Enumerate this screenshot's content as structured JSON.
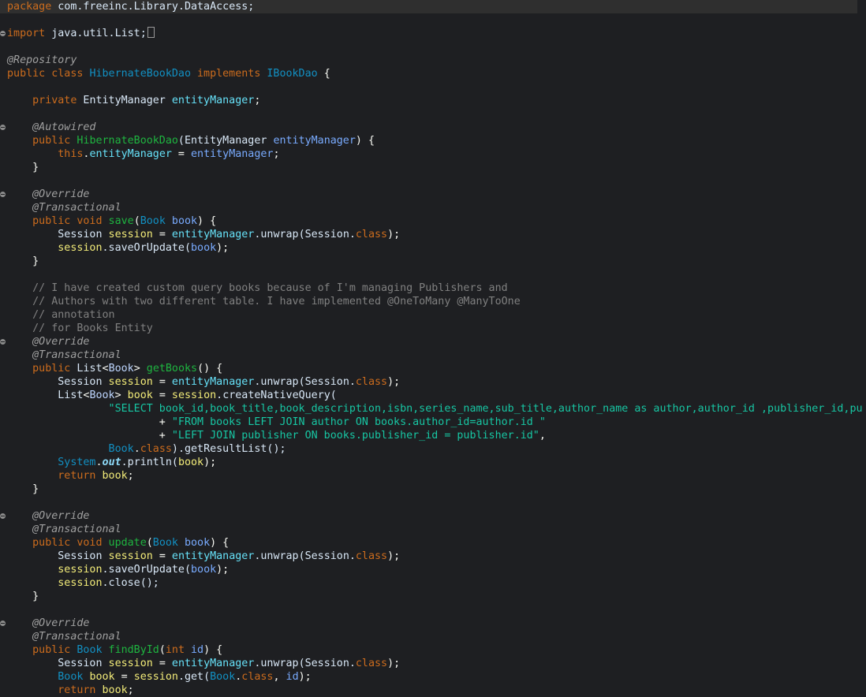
{
  "editor": {
    "language": "java",
    "current_line": 0,
    "lines": [
      {
        "fold": false,
        "folded_box": false,
        "tokens": [
          {
            "t": "package",
            "c": "#cc6c1d"
          },
          {
            "t": " com.freeinc.Library.DataAccess;",
            "c": "#d9e8f7"
          }
        ]
      },
      {
        "fold": false,
        "folded_box": false,
        "tokens": []
      },
      {
        "fold": true,
        "folded_box": true,
        "tokens": [
          {
            "t": "import",
            "c": "#cc6c1d"
          },
          {
            "t": " java.util.List;",
            "c": "#d9e8f7"
          }
        ]
      },
      {
        "fold": false,
        "folded_box": false,
        "tokens": []
      },
      {
        "fold": false,
        "folded_box": false,
        "tokens": [
          {
            "t": "@Repository",
            "c": "#a0a0a0",
            "i": true
          }
        ]
      },
      {
        "fold": false,
        "folded_box": false,
        "tokens": [
          {
            "t": "public class ",
            "c": "#cc6c1d"
          },
          {
            "t": "HibernateBookDao",
            "c": "#1290c3"
          },
          {
            "t": " implements ",
            "c": "#cc6c1d"
          },
          {
            "t": "IBookDao",
            "c": "#1290c3"
          },
          {
            "t": " {",
            "c": "#f9faf4"
          }
        ]
      },
      {
        "fold": false,
        "folded_box": false,
        "tokens": []
      },
      {
        "fold": false,
        "folded_box": false,
        "tokens": [
          {
            "t": "    private ",
            "c": "#cc6c1d"
          },
          {
            "t": "EntityManager",
            "c": "#d9e8f7"
          },
          {
            "t": " entityManager",
            "c": "#66e1f8"
          },
          {
            "t": ";",
            "c": "#f9faf4"
          }
        ]
      },
      {
        "fold": false,
        "folded_box": false,
        "tokens": []
      },
      {
        "fold": true,
        "folded_box": false,
        "tokens": [
          {
            "t": "    @Autowired",
            "c": "#a0a0a0",
            "i": true
          }
        ]
      },
      {
        "fold": false,
        "folded_box": false,
        "tokens": [
          {
            "t": "    public ",
            "c": "#cc6c1d"
          },
          {
            "t": "HibernateBookDao",
            "c": "#1eb540"
          },
          {
            "t": "(EntityManager ",
            "c": "#d9e8f7"
          },
          {
            "t": "entityManager",
            "c": "#79abff"
          },
          {
            "t": ") {",
            "c": "#f9faf4"
          }
        ]
      },
      {
        "fold": false,
        "folded_box": false,
        "tokens": [
          {
            "t": "        this",
            "c": "#cc6c1d"
          },
          {
            "t": ".",
            "c": "#f9faf4"
          },
          {
            "t": "entityManager",
            "c": "#66e1f8"
          },
          {
            "t": " = ",
            "c": "#f9faf4"
          },
          {
            "t": "entityManager",
            "c": "#79abff"
          },
          {
            "t": ";",
            "c": "#f9faf4"
          }
        ]
      },
      {
        "fold": false,
        "folded_box": false,
        "tokens": [
          {
            "t": "    }",
            "c": "#f9faf4"
          }
        ]
      },
      {
        "fold": false,
        "folded_box": false,
        "tokens": []
      },
      {
        "fold": true,
        "folded_box": false,
        "tokens": [
          {
            "t": "    @Override",
            "c": "#a0a0a0",
            "i": true
          }
        ]
      },
      {
        "fold": false,
        "folded_box": false,
        "tokens": [
          {
            "t": "    @Transactional",
            "c": "#a0a0a0",
            "i": true
          }
        ]
      },
      {
        "fold": false,
        "folded_box": false,
        "tokens": [
          {
            "t": "    public void ",
            "c": "#cc6c1d"
          },
          {
            "t": "save",
            "c": "#1eb540"
          },
          {
            "t": "(",
            "c": "#f9faf4"
          },
          {
            "t": "Book",
            "c": "#1290c3"
          },
          {
            "t": " book",
            "c": "#79abff"
          },
          {
            "t": ") {",
            "c": "#f9faf4"
          }
        ]
      },
      {
        "fold": false,
        "folded_box": false,
        "tokens": [
          {
            "t": "        Session ",
            "c": "#d9e8f7"
          },
          {
            "t": "session",
            "c": "#f3ec79"
          },
          {
            "t": " = ",
            "c": "#f9faf4"
          },
          {
            "t": "entityManager",
            "c": "#66e1f8"
          },
          {
            "t": ".unwrap(Session.",
            "c": "#d9e8f7"
          },
          {
            "t": "class",
            "c": "#cc6c1d"
          },
          {
            "t": ");",
            "c": "#f9faf4"
          }
        ]
      },
      {
        "fold": false,
        "folded_box": false,
        "tokens": [
          {
            "t": "        session",
            "c": "#f3ec79"
          },
          {
            "t": ".saveOrUpdate(",
            "c": "#d9e8f7"
          },
          {
            "t": "book",
            "c": "#79abff"
          },
          {
            "t": ");",
            "c": "#f9faf4"
          }
        ]
      },
      {
        "fold": false,
        "folded_box": false,
        "tokens": [
          {
            "t": "    }",
            "c": "#f9faf4"
          }
        ]
      },
      {
        "fold": false,
        "folded_box": false,
        "tokens": []
      },
      {
        "fold": false,
        "folded_box": false,
        "tokens": [
          {
            "t": "    // I have created custom query books because of I'm managing Publishers and",
            "c": "#808080"
          }
        ]
      },
      {
        "fold": false,
        "folded_box": false,
        "tokens": [
          {
            "t": "    // Authors with two different table. I have implemented @OneToMany @ManyToOne",
            "c": "#808080"
          }
        ]
      },
      {
        "fold": false,
        "folded_box": false,
        "tokens": [
          {
            "t": "    // annotation",
            "c": "#808080"
          }
        ]
      },
      {
        "fold": false,
        "folded_box": false,
        "tokens": [
          {
            "t": "    // for Books Entity",
            "c": "#808080"
          }
        ]
      },
      {
        "fold": true,
        "folded_box": false,
        "tokens": [
          {
            "t": "    @Override",
            "c": "#a0a0a0",
            "i": true
          }
        ]
      },
      {
        "fold": false,
        "folded_box": false,
        "tokens": [
          {
            "t": "    @Transactional",
            "c": "#a0a0a0",
            "i": true
          }
        ]
      },
      {
        "fold": false,
        "folded_box": false,
        "tokens": [
          {
            "t": "    public ",
            "c": "#cc6c1d"
          },
          {
            "t": "List",
            "c": "#d9e8f7"
          },
          {
            "t": "<",
            "c": "#f9faf4"
          },
          {
            "t": "Book",
            "c": "#bed6ff"
          },
          {
            "t": "> ",
            "c": "#f9faf4"
          },
          {
            "t": "getBooks",
            "c": "#1eb540"
          },
          {
            "t": "() {",
            "c": "#f9faf4"
          }
        ]
      },
      {
        "fold": false,
        "folded_box": false,
        "tokens": [
          {
            "t": "        Session ",
            "c": "#d9e8f7"
          },
          {
            "t": "session",
            "c": "#f3ec79"
          },
          {
            "t": " = ",
            "c": "#f9faf4"
          },
          {
            "t": "entityManager",
            "c": "#66e1f8"
          },
          {
            "t": ".unwrap(Session.",
            "c": "#d9e8f7"
          },
          {
            "t": "class",
            "c": "#cc6c1d"
          },
          {
            "t": ");",
            "c": "#f9faf4"
          }
        ]
      },
      {
        "fold": false,
        "folded_box": false,
        "tokens": [
          {
            "t": "        List",
            "c": "#d9e8f7"
          },
          {
            "t": "<",
            "c": "#f9faf4"
          },
          {
            "t": "Book",
            "c": "#bed6ff"
          },
          {
            "t": "> ",
            "c": "#f9faf4"
          },
          {
            "t": "book",
            "c": "#f3ec79"
          },
          {
            "t": " = ",
            "c": "#f9faf4"
          },
          {
            "t": "session",
            "c": "#f3ec79"
          },
          {
            "t": ".createNativeQuery(",
            "c": "#d9e8f7"
          }
        ]
      },
      {
        "fold": false,
        "folded_box": false,
        "tokens": [
          {
            "t": "                \"SELECT book_id,book_title,book_description,isbn,series_name,sub_title,author_name as author,author_id ,publisher_id,pu",
            "c": "#17c6a3"
          }
        ]
      },
      {
        "fold": false,
        "folded_box": false,
        "tokens": [
          {
            "t": "                        + ",
            "c": "#f9faf4"
          },
          {
            "t": "\"FROM books LEFT JOIN author ON books.author_id=author.id \"",
            "c": "#17c6a3"
          }
        ]
      },
      {
        "fold": false,
        "folded_box": false,
        "tokens": [
          {
            "t": "                        + ",
            "c": "#f9faf4"
          },
          {
            "t": "\"LEFT JOIN publisher ON books.publisher_id = publisher.id\"",
            "c": "#17c6a3"
          },
          {
            "t": ",",
            "c": "#f9faf4"
          }
        ]
      },
      {
        "fold": false,
        "folded_box": false,
        "tokens": [
          {
            "t": "                Book",
            "c": "#1290c3"
          },
          {
            "t": ".",
            "c": "#f9faf4"
          },
          {
            "t": "class",
            "c": "#cc6c1d"
          },
          {
            "t": ").getResultList();",
            "c": "#d9e8f7"
          }
        ]
      },
      {
        "fold": false,
        "folded_box": false,
        "tokens": [
          {
            "t": "        System",
            "c": "#1290c3"
          },
          {
            "t": ".",
            "c": "#f9faf4"
          },
          {
            "t": "out",
            "c": "#8dd9f8",
            "i": true,
            "b": true
          },
          {
            "t": ".println(",
            "c": "#d9e8f7"
          },
          {
            "t": "book",
            "c": "#f3ec79"
          },
          {
            "t": ");",
            "c": "#f9faf4"
          }
        ]
      },
      {
        "fold": false,
        "folded_box": false,
        "tokens": [
          {
            "t": "        return ",
            "c": "#cc6c1d"
          },
          {
            "t": "book",
            "c": "#f3ec79"
          },
          {
            "t": ";",
            "c": "#f9faf4"
          }
        ]
      },
      {
        "fold": false,
        "folded_box": false,
        "tokens": [
          {
            "t": "    }",
            "c": "#f9faf4"
          }
        ]
      },
      {
        "fold": false,
        "folded_box": false,
        "tokens": []
      },
      {
        "fold": true,
        "folded_box": false,
        "tokens": [
          {
            "t": "    @Override",
            "c": "#a0a0a0",
            "i": true
          }
        ]
      },
      {
        "fold": false,
        "folded_box": false,
        "tokens": [
          {
            "t": "    @Transactional",
            "c": "#a0a0a0",
            "i": true
          }
        ]
      },
      {
        "fold": false,
        "folded_box": false,
        "tokens": [
          {
            "t": "    public void ",
            "c": "#cc6c1d"
          },
          {
            "t": "update",
            "c": "#1eb540"
          },
          {
            "t": "(",
            "c": "#f9faf4"
          },
          {
            "t": "Book",
            "c": "#1290c3"
          },
          {
            "t": " book",
            "c": "#79abff"
          },
          {
            "t": ") {",
            "c": "#f9faf4"
          }
        ]
      },
      {
        "fold": false,
        "folded_box": false,
        "tokens": [
          {
            "t": "        Session ",
            "c": "#d9e8f7"
          },
          {
            "t": "session",
            "c": "#f3ec79"
          },
          {
            "t": " = ",
            "c": "#f9faf4"
          },
          {
            "t": "entityManager",
            "c": "#66e1f8"
          },
          {
            "t": ".unwrap(Session.",
            "c": "#d9e8f7"
          },
          {
            "t": "class",
            "c": "#cc6c1d"
          },
          {
            "t": ");",
            "c": "#f9faf4"
          }
        ]
      },
      {
        "fold": false,
        "folded_box": false,
        "tokens": [
          {
            "t": "        session",
            "c": "#f3ec79"
          },
          {
            "t": ".saveOrUpdate(",
            "c": "#d9e8f7"
          },
          {
            "t": "book",
            "c": "#79abff"
          },
          {
            "t": ");",
            "c": "#f9faf4"
          }
        ]
      },
      {
        "fold": false,
        "folded_box": false,
        "tokens": [
          {
            "t": "        session",
            "c": "#f3ec79"
          },
          {
            "t": ".close();",
            "c": "#d9e8f7"
          }
        ]
      },
      {
        "fold": false,
        "folded_box": false,
        "tokens": [
          {
            "t": "    }",
            "c": "#f9faf4"
          }
        ]
      },
      {
        "fold": false,
        "folded_box": false,
        "tokens": []
      },
      {
        "fold": true,
        "folded_box": false,
        "tokens": [
          {
            "t": "    @Override",
            "c": "#a0a0a0",
            "i": true
          }
        ]
      },
      {
        "fold": false,
        "folded_box": false,
        "tokens": [
          {
            "t": "    @Transactional",
            "c": "#a0a0a0",
            "i": true
          }
        ]
      },
      {
        "fold": false,
        "folded_box": false,
        "tokens": [
          {
            "t": "    public ",
            "c": "#cc6c1d"
          },
          {
            "t": "Book",
            "c": "#1290c3"
          },
          {
            "t": " findById",
            "c": "#1eb540"
          },
          {
            "t": "(",
            "c": "#f9faf4"
          },
          {
            "t": "int",
            "c": "#cc6c1d"
          },
          {
            "t": " id",
            "c": "#79abff"
          },
          {
            "t": ") {",
            "c": "#f9faf4"
          }
        ]
      },
      {
        "fold": false,
        "folded_box": false,
        "tokens": [
          {
            "t": "        Session ",
            "c": "#d9e8f7"
          },
          {
            "t": "session",
            "c": "#f3ec79"
          },
          {
            "t": " = ",
            "c": "#f9faf4"
          },
          {
            "t": "entityManager",
            "c": "#66e1f8"
          },
          {
            "t": ".unwrap(Session.",
            "c": "#d9e8f7"
          },
          {
            "t": "class",
            "c": "#cc6c1d"
          },
          {
            "t": ");",
            "c": "#f9faf4"
          }
        ]
      },
      {
        "fold": false,
        "folded_box": false,
        "tokens": [
          {
            "t": "        Book",
            "c": "#1290c3"
          },
          {
            "t": " book",
            "c": "#f3ec79"
          },
          {
            "t": " = ",
            "c": "#f9faf4"
          },
          {
            "t": "session",
            "c": "#f3ec79"
          },
          {
            "t": ".get(",
            "c": "#d9e8f7"
          },
          {
            "t": "Book",
            "c": "#1290c3"
          },
          {
            "t": ".",
            "c": "#f9faf4"
          },
          {
            "t": "class",
            "c": "#cc6c1d"
          },
          {
            "t": ", ",
            "c": "#f9faf4"
          },
          {
            "t": "id",
            "c": "#79abff"
          },
          {
            "t": ");",
            "c": "#f9faf4"
          }
        ]
      },
      {
        "fold": false,
        "folded_box": false,
        "tokens": [
          {
            "t": "        return ",
            "c": "#cc6c1d"
          },
          {
            "t": "book",
            "c": "#f3ec79"
          },
          {
            "t": ";",
            "c": "#f9faf4"
          }
        ]
      }
    ]
  }
}
